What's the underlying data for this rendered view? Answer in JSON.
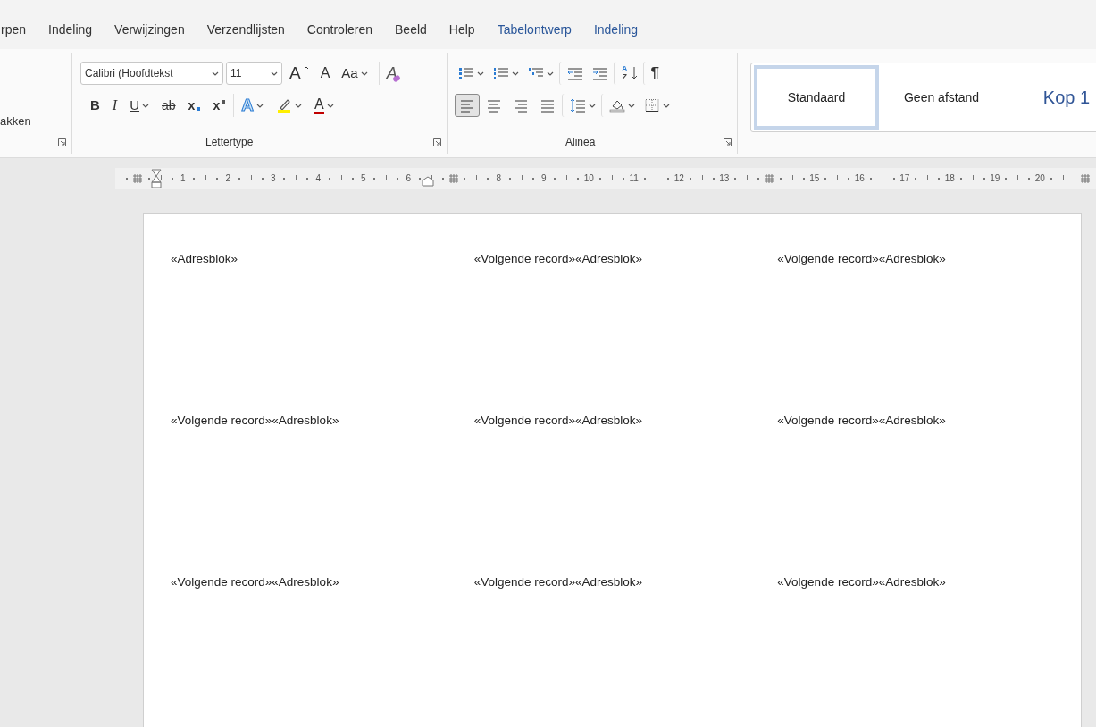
{
  "tabs": [
    {
      "label": "rpen",
      "contextual": false
    },
    {
      "label": "Indeling",
      "contextual": false
    },
    {
      "label": "Verwijzingen",
      "contextual": false
    },
    {
      "label": "Verzendlijsten",
      "contextual": false
    },
    {
      "label": "Controleren",
      "contextual": false
    },
    {
      "label": "Beeld",
      "contextual": false
    },
    {
      "label": "Help",
      "contextual": false
    },
    {
      "label": "Tabelontwerp",
      "contextual": true
    },
    {
      "label": "Indeling",
      "contextual": true
    }
  ],
  "clipboard_group": {
    "label": "akken"
  },
  "font_group": {
    "font_name": "Calibri (Hoofdtekst",
    "font_size": "11",
    "label": "Lettertype",
    "row1": [
      {
        "kind": "grow",
        "glyph": "A"
      },
      {
        "kind": "shrink",
        "glyph": "A"
      },
      {
        "kind": "case",
        "glyph": "Aa"
      },
      {
        "kind": "clear",
        "glyph": "A"
      }
    ],
    "row2": [
      {
        "kind": "bold",
        "glyph": "B"
      },
      {
        "kind": "italic",
        "glyph": "I"
      },
      {
        "kind": "underline",
        "glyph": "U"
      },
      {
        "kind": "strike",
        "glyph": "ab"
      },
      {
        "kind": "sub",
        "glyph": "x"
      },
      {
        "kind": "sup",
        "glyph": "x"
      },
      {
        "kind": "effects",
        "glyph": "A"
      },
      {
        "kind": "highlight"
      },
      {
        "kind": "color",
        "glyph": "A"
      }
    ]
  },
  "paragraph_group": {
    "label": "Alinea",
    "row1": [
      {
        "kind": "bullets"
      },
      {
        "kind": "numbering"
      },
      {
        "kind": "multilevel"
      },
      {
        "kind": "outdent"
      },
      {
        "kind": "indent"
      },
      {
        "kind": "sort",
        "glyph_top": "A",
        "glyph_bottom": "Z"
      },
      {
        "kind": "pilcrow",
        "glyph": "¶"
      }
    ],
    "row2": [
      {
        "kind": "align-left",
        "selected": true
      },
      {
        "kind": "align-center",
        "selected": false
      },
      {
        "kind": "align-right",
        "selected": false
      },
      {
        "kind": "justify",
        "selected": false
      },
      {
        "kind": "spacing"
      },
      {
        "kind": "shading"
      },
      {
        "kind": "borders"
      }
    ]
  },
  "styles": [
    {
      "label": "Standaard",
      "kind": "normal",
      "selected": true
    },
    {
      "label": "Geen afstand",
      "kind": "normal",
      "selected": false
    },
    {
      "label": "Kop 1",
      "kind": "heading",
      "selected": false
    }
  ],
  "ruler": [
    {
      "kind": "marker"
    },
    {
      "kind": "number",
      "text": "1"
    },
    {
      "kind": "number",
      "text": "2"
    },
    {
      "kind": "number",
      "text": "3"
    },
    {
      "kind": "number",
      "text": "4"
    },
    {
      "kind": "number",
      "text": "5"
    },
    {
      "kind": "number",
      "text": "6"
    },
    {
      "kind": "marker"
    },
    {
      "kind": "number",
      "text": "8"
    },
    {
      "kind": "number",
      "text": "9"
    },
    {
      "kind": "number",
      "text": "10"
    },
    {
      "kind": "number",
      "text": "11"
    },
    {
      "kind": "number",
      "text": "12"
    },
    {
      "kind": "number",
      "text": "13"
    },
    {
      "kind": "marker"
    },
    {
      "kind": "number",
      "text": "15"
    },
    {
      "kind": "number",
      "text": "16"
    },
    {
      "kind": "number",
      "text": "17"
    },
    {
      "kind": "number",
      "text": "18"
    },
    {
      "kind": "number",
      "text": "19"
    },
    {
      "kind": "number",
      "text": "20"
    },
    {
      "kind": "marker"
    }
  ],
  "labels": [
    "«Adresblok»",
    "«Volgende record»«Adresblok»",
    "«Volgende record»«Adresblok»",
    "«Volgende record»«Adresblok»",
    "«Volgende record»«Adresblok»",
    "«Volgende record»«Adresblok»",
    "«Volgende record»«Adresblok»",
    "«Volgende record»«Adresblok»",
    "«Volgende record»«Adresblok»"
  ]
}
